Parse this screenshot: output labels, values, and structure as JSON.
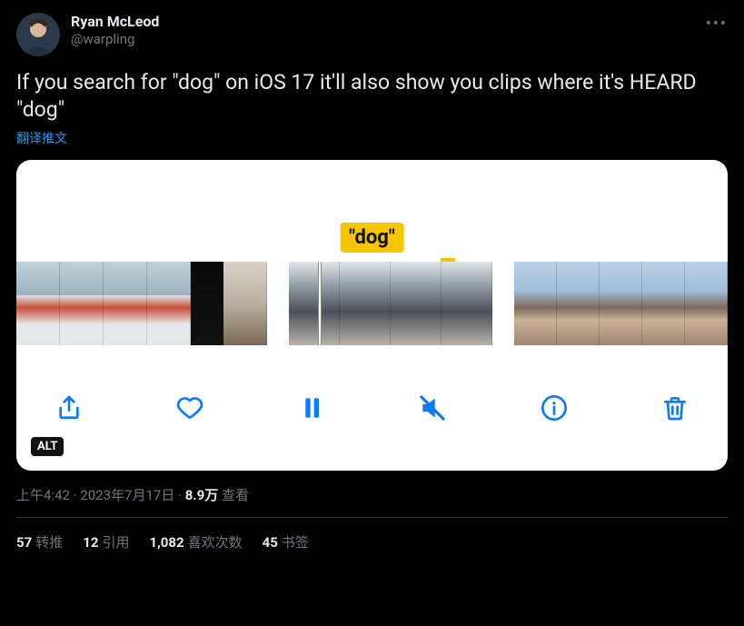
{
  "author": {
    "display_name": "Ryan McLeod",
    "handle": "@warpling"
  },
  "tweet_text": "If you search for \"dog\" on iOS 17 it'll also show you clips where it's HEARD \"dog\"",
  "translate_label": "翻译推文",
  "media": {
    "search_token": "\"dog\"",
    "alt_badge": "ALT"
  },
  "timestamp": {
    "time": "上午4:42",
    "date": "2023年7月17日",
    "views_number": "8.9万",
    "views_label": " 查看",
    "separator": " · "
  },
  "engagement": {
    "retweets_count": "57",
    "retweets_label": "转推",
    "quotes_count": "12",
    "quotes_label": "引用",
    "likes_count": "1,082",
    "likes_label": "喜欢次数",
    "bookmarks_count": "45",
    "bookmarks_label": "书签"
  }
}
